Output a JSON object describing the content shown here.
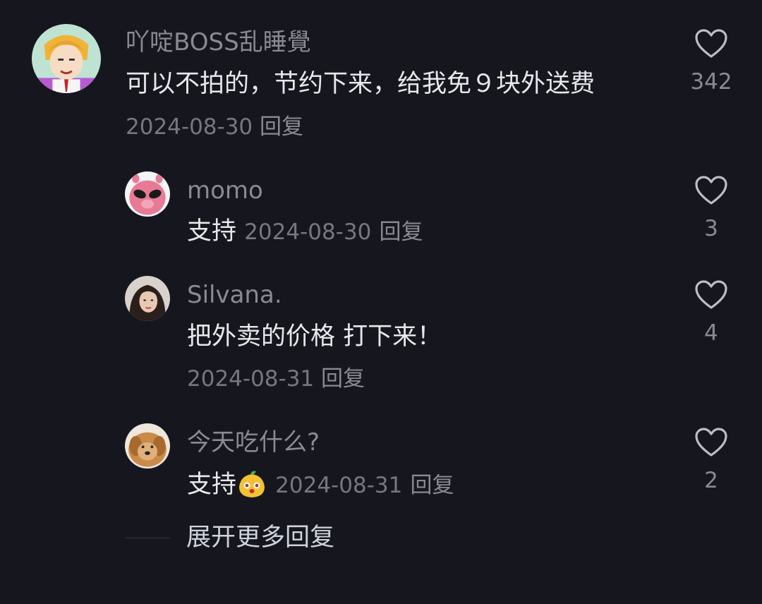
{
  "comments": [
    {
      "username": "吖啶BOSS乱睡覺",
      "text": "可以不拍的，节约下来，给我免９块外送费",
      "date": "2024-08-30",
      "reply_label": "回复",
      "likes": "342",
      "avatar": "anime-boy-avatar"
    }
  ],
  "replies": [
    {
      "username": "momo",
      "text": "支持",
      "date": "2024-08-30",
      "reply_label": "回复",
      "likes": "3",
      "avatar": "pink-alien-avatar"
    },
    {
      "username": "Silvana.",
      "text": "把外卖的价格 打下来！",
      "date": "2024-08-31",
      "reply_label": "回复",
      "likes": "4",
      "avatar": "woman-portrait-avatar"
    },
    {
      "username": "今天吃什么?",
      "text": "支持",
      "emoji": "mango-face-emoji",
      "date": "2024-08-31",
      "reply_label": "回复",
      "likes": "2",
      "avatar": "golden-dog-avatar"
    }
  ],
  "expand_more_label": "展开更多回复",
  "icons": {
    "like": "heart-outline-icon"
  },
  "colors": {
    "background": "#16161e",
    "username": "#8a8a91",
    "text": "#e8e8ec",
    "meta": "#77777e"
  }
}
